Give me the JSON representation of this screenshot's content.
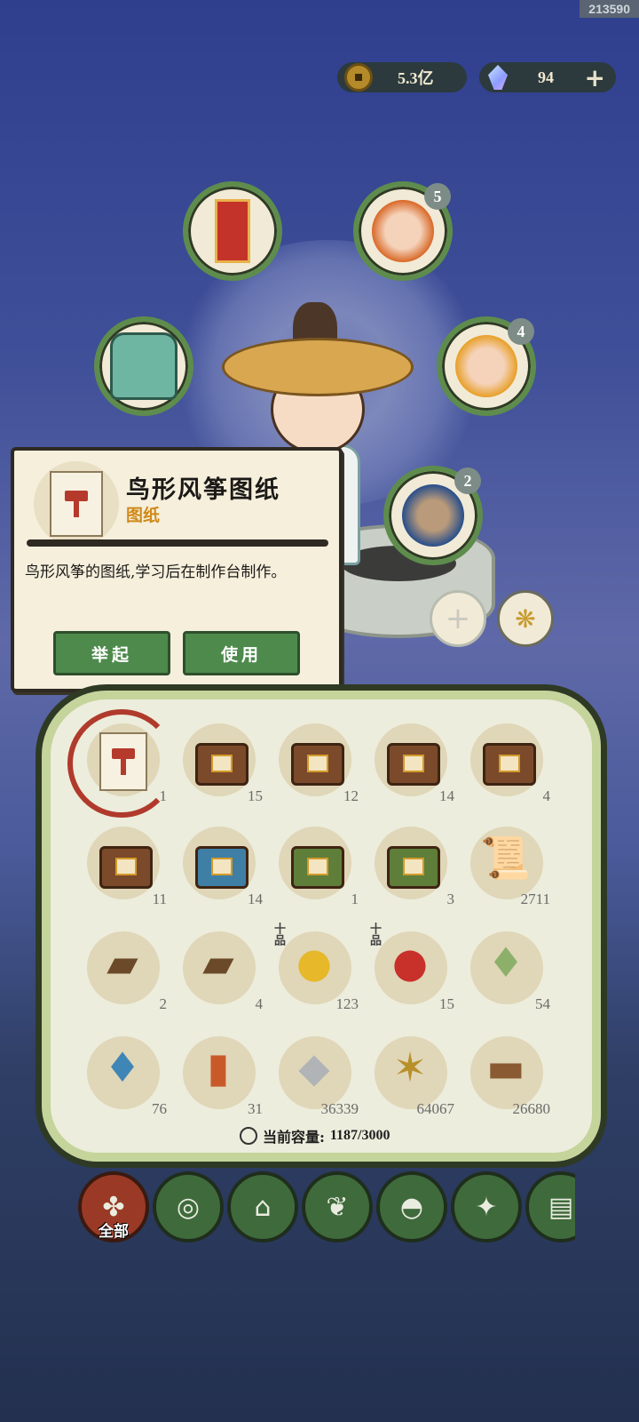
{
  "session_id": "213590",
  "currency": {
    "coins": "5.3亿",
    "gems": "94"
  },
  "slots": [
    {
      "name": "talisman-slot",
      "badge": ""
    },
    {
      "name": "hero-slot-1",
      "badge": "5"
    },
    {
      "name": "armor-slot",
      "badge": ""
    },
    {
      "name": "hero-slot-2",
      "badge": "4"
    },
    {
      "name": "hero-slot-3",
      "badge": "2"
    }
  ],
  "tooltip": {
    "title": "鸟形风筝图纸",
    "type": "图纸",
    "description": "鸟形风筝的图纸,学习后在制作台制作。",
    "btn_lift": "举起",
    "btn_use": "使用"
  },
  "inventory": [
    {
      "icon": "blueprint",
      "count": "1",
      "tag": ""
    },
    {
      "icon": "chest",
      "count": "15",
      "tag": ""
    },
    {
      "icon": "chest",
      "count": "12",
      "tag": ""
    },
    {
      "icon": "chest",
      "count": "14",
      "tag": ""
    },
    {
      "icon": "chest",
      "count": "4",
      "tag": ""
    },
    {
      "icon": "chest",
      "count": "11",
      "tag": ""
    },
    {
      "icon": "chest-blue",
      "count": "14",
      "tag": ""
    },
    {
      "icon": "chest-green",
      "count": "1",
      "tag": ""
    },
    {
      "icon": "chest-green",
      "count": "3",
      "tag": ""
    },
    {
      "icon": "scroll",
      "count": "2711",
      "tag": ""
    },
    {
      "icon": "tray",
      "count": "2",
      "tag": ""
    },
    {
      "icon": "tray",
      "count": "4",
      "tag": ""
    },
    {
      "icon": "yellow-berries",
      "count": "123",
      "tag": "十品"
    },
    {
      "icon": "red-berries",
      "count": "15",
      "tag": "十品"
    },
    {
      "icon": "green-pouch",
      "count": "54",
      "tag": ""
    },
    {
      "icon": "blue-pouch",
      "count": "76",
      "tag": ""
    },
    {
      "icon": "token",
      "count": "31",
      "tag": ""
    },
    {
      "icon": "stone",
      "count": "36339",
      "tag": ""
    },
    {
      "icon": "grass",
      "count": "64067",
      "tag": ""
    },
    {
      "icon": "log",
      "count": "26680",
      "tag": ""
    }
  ],
  "capacity": {
    "label": "当前容量:",
    "value": "1187/3000"
  },
  "filters": [
    {
      "name": "all",
      "label": "全部",
      "icon": "grid-icon"
    },
    {
      "name": "wood",
      "label": "",
      "icon": "log-icon"
    },
    {
      "name": "building",
      "label": "",
      "icon": "house-icon"
    },
    {
      "name": "herb",
      "label": "",
      "icon": "leaf-icon"
    },
    {
      "name": "food",
      "label": "",
      "icon": "bowl-icon"
    },
    {
      "name": "material",
      "label": "",
      "icon": "ore-icon"
    },
    {
      "name": "book",
      "label": "",
      "icon": "book-icon"
    }
  ]
}
